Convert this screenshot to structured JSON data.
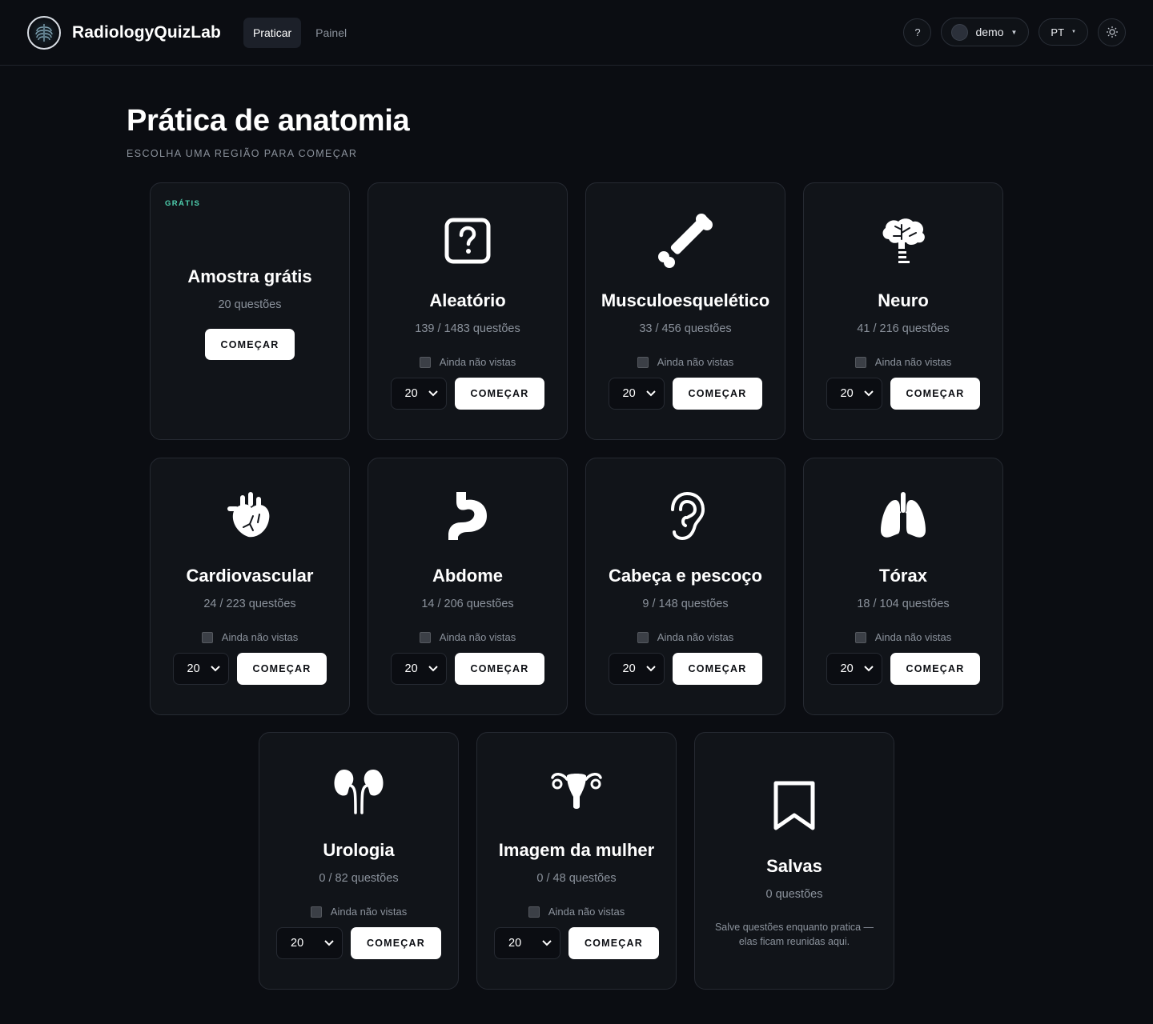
{
  "app": {
    "brand": "RadiologyQuizLab"
  },
  "nav": {
    "tabs": [
      {
        "label": "Praticar",
        "active": true
      },
      {
        "label": "Painel",
        "active": false
      }
    ]
  },
  "header": {
    "help_label": "?",
    "user_name": "demo",
    "language": "PT"
  },
  "page": {
    "title": "Prática de anatomia",
    "subtitle": "ESCOLHA UMA REGIÃO PARA COMEÇAR"
  },
  "cards": {
    "sample": {
      "badge": "GRÁTIS",
      "title": "Amostra grátis",
      "count": "20 questões",
      "button": "COMEÇAR"
    },
    "random": {
      "icon": "question-square-icon",
      "title": "Aleatório",
      "count": "139 / 1483 questões",
      "filter": "Ainda não vistas",
      "select": "20",
      "button": "COMEÇAR"
    },
    "msk": {
      "icon": "bone-icon",
      "title": "Musculoesquelético",
      "count": "33 / 456 questões",
      "filter": "Ainda não vistas",
      "select": "20",
      "button": "COMEÇAR"
    },
    "neuro": {
      "icon": "brain-icon",
      "title": "Neuro",
      "count": "41 / 216 questões",
      "filter": "Ainda não vistas",
      "select": "20",
      "button": "COMEÇAR"
    },
    "cardio": {
      "icon": "heart-icon",
      "title": "Cardiovascular",
      "count": "24 / 223 questões",
      "filter": "Ainda não vistas",
      "select": "20",
      "button": "COMEÇAR"
    },
    "abdomen": {
      "icon": "stomach-icon",
      "title": "Abdome",
      "count": "14 / 206 questões",
      "filter": "Ainda não vistas",
      "select": "20",
      "button": "COMEÇAR"
    },
    "headneck": {
      "icon": "ear-icon",
      "title": "Cabeça e pescoço",
      "count": "9 / 148 questões",
      "filter": "Ainda não vistas",
      "select": "20",
      "button": "COMEÇAR"
    },
    "thorax": {
      "icon": "lungs-icon",
      "title": "Tórax",
      "count": "18 / 104 questões",
      "filter": "Ainda não vistas",
      "select": "20",
      "button": "COMEÇAR"
    },
    "uro": {
      "icon": "kidneys-icon",
      "title": "Urologia",
      "count": "0 / 82 questões",
      "filter": "Ainda não vistas",
      "select": "20",
      "button": "COMEÇAR"
    },
    "women": {
      "icon": "uterus-icon",
      "title": "Imagem da mulher",
      "count": "0 / 48 questões",
      "filter": "Ainda não vistas",
      "select": "20",
      "button": "COMEÇAR"
    },
    "saved": {
      "icon": "bookmark-icon",
      "title": "Salvas",
      "count": "0 questões",
      "note": "Salve questões enquanto pratica — elas ficam reunidas aqui."
    }
  },
  "colors": {
    "background": "#0b0d12",
    "card": "#111419",
    "accent_free": "#4fd1b0",
    "button": "#ffffff"
  }
}
